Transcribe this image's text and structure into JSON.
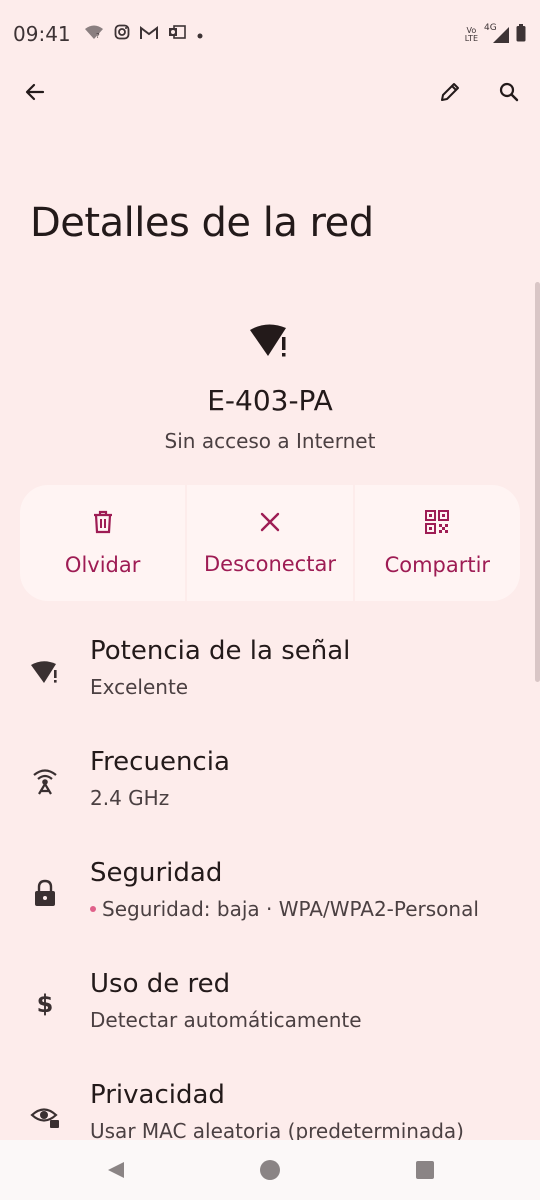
{
  "status_bar": {
    "time": "09:41",
    "network_type": "4G",
    "volte_top": "Vo",
    "volte_bottom": "LTE",
    "left_icons": [
      "wifi-question-icon",
      "instagram-icon",
      "gmail-icon",
      "outlook-icon",
      "dot-icon"
    ],
    "right_icons": [
      "volte-icon",
      "signal-icon",
      "battery-icon"
    ]
  },
  "app_bar": {
    "icons": [
      "back-arrow-icon",
      "edit-pencil-icon",
      "search-icon"
    ]
  },
  "page": {
    "title": "Detalles de la red"
  },
  "network": {
    "name": "E-403-PA",
    "status": "Sin acceso a Internet",
    "icon": "wifi-warning-icon"
  },
  "actions": [
    {
      "label": "Olvidar",
      "icon": "trash-icon"
    },
    {
      "label": "Desconectar",
      "icon": "close-icon"
    },
    {
      "label": "Compartir",
      "icon": "qr-code-icon"
    }
  ],
  "details": [
    {
      "title": "Potencia de la señal",
      "subtitle": "Excelente",
      "icon": "wifi-warning-icon"
    },
    {
      "title": "Frecuencia",
      "subtitle": "2.4 GHz",
      "icon": "antenna-icon"
    },
    {
      "title": "Seguridad",
      "subtitle": "Seguridad: baja · WPA/WPA2-Personal",
      "icon": "lock-icon"
    },
    {
      "title": "Uso de red",
      "subtitle": "Detectar automáticamente",
      "icon": "dollar-icon"
    },
    {
      "title": "Privacidad",
      "subtitle": "Usar MAC aleatoria (predeterminada)",
      "icon": "privacy-eye-icon"
    }
  ],
  "colors": {
    "background": "#fdeceb",
    "accent": "#9e1c54",
    "card": "#fff4f3",
    "text_primary": "#231a1a",
    "text_secondary": "#4b4042",
    "security_dot": "#e0608a"
  },
  "nav_bar": {
    "icons": [
      "nav-back-icon",
      "nav-home-icon",
      "nav-recents-icon"
    ]
  }
}
